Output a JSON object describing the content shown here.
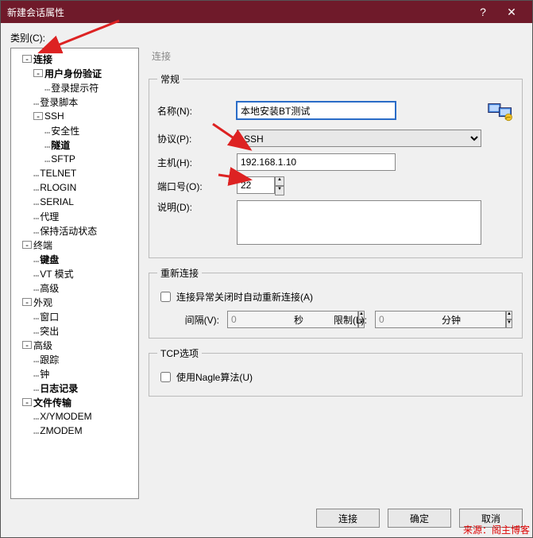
{
  "window": {
    "title": "新建会话属性",
    "help": "?",
    "close": "✕"
  },
  "category_label": "类别(C):",
  "tree": [
    {
      "label": "连接",
      "bold": true,
      "exp": "-",
      "ind": 1
    },
    {
      "label": "用户身份验证",
      "bold": true,
      "exp": "-",
      "ind": 2
    },
    {
      "label": "登录提示符",
      "bold": false,
      "ind": 3
    },
    {
      "label": "登录脚本",
      "bold": false,
      "ind": 2
    },
    {
      "label": "SSH",
      "bold": false,
      "exp": "-",
      "ind": 2
    },
    {
      "label": "安全性",
      "bold": false,
      "ind": 3
    },
    {
      "label": "隧道",
      "bold": true,
      "ind": 3
    },
    {
      "label": "SFTP",
      "bold": false,
      "ind": 3
    },
    {
      "label": "TELNET",
      "bold": false,
      "ind": 2
    },
    {
      "label": "RLOGIN",
      "bold": false,
      "ind": 2
    },
    {
      "label": "SERIAL",
      "bold": false,
      "ind": 2
    },
    {
      "label": "代理",
      "bold": false,
      "ind": 2
    },
    {
      "label": "保持活动状态",
      "bold": false,
      "ind": 2
    },
    {
      "label": "终端",
      "bold": false,
      "exp": "-",
      "ind": 1
    },
    {
      "label": "键盘",
      "bold": true,
      "ind": 2
    },
    {
      "label": "VT 模式",
      "bold": false,
      "ind": 2
    },
    {
      "label": "高级",
      "bold": false,
      "ind": 2
    },
    {
      "label": "外观",
      "bold": false,
      "exp": "-",
      "ind": 1
    },
    {
      "label": "窗口",
      "bold": false,
      "ind": 2
    },
    {
      "label": "突出",
      "bold": false,
      "ind": 2
    },
    {
      "label": "高级",
      "bold": false,
      "exp": "-",
      "ind": 1
    },
    {
      "label": "跟踪",
      "bold": false,
      "ind": 2
    },
    {
      "label": "钟",
      "bold": false,
      "ind": 2
    },
    {
      "label": "日志记录",
      "bold": true,
      "ind": 2
    },
    {
      "label": "文件传输",
      "bold": true,
      "exp": "-",
      "ind": 1
    },
    {
      "label": "X/YMODEM",
      "bold": false,
      "ind": 2
    },
    {
      "label": "ZMODEM",
      "bold": false,
      "ind": 2
    }
  ],
  "right": {
    "section_title": "连接",
    "general": {
      "legend": "常规",
      "name_label": "名称(N):",
      "name_value": "本地安装BT测试",
      "proto_label": "协议(P):",
      "proto_value": "SSH",
      "host_label": "主机(H):",
      "host_value": "192.168.1.10",
      "port_label": "端口号(O):",
      "port_value": "22",
      "desc_label": "说明(D):",
      "desc_value": ""
    },
    "reconnect": {
      "legend": "重新连接",
      "checkbox": "连接异常关闭时自动重新连接(A)",
      "interval_label": "间隔(V):",
      "interval_value": "0",
      "interval_unit": "秒",
      "limit_label": "限制(L):",
      "limit_value": "0",
      "limit_unit": "分钟"
    },
    "tcp": {
      "legend": "TCP选项",
      "nagle": "使用Nagle算法(U)"
    }
  },
  "buttons": {
    "connect": "连接",
    "ok": "确定",
    "cancel": "取消"
  },
  "watermark": "来源：阁主博客"
}
